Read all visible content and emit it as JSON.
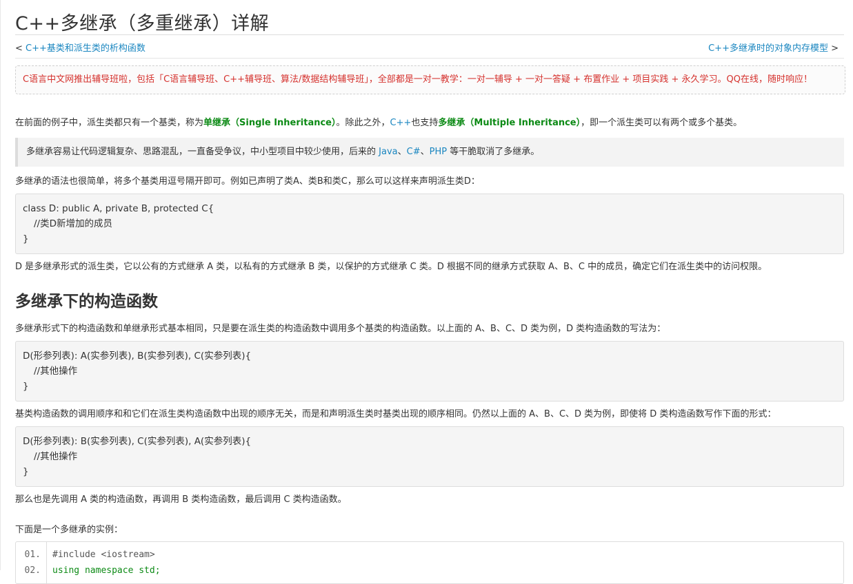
{
  "article": {
    "title": "C++多继承（多重继承）详解",
    "nav": {
      "prev_prefix": "< ",
      "prev_label": "C++基类和派生类的析构函数",
      "next_label": "C++多继承时的对象内存模型",
      "next_suffix": " >"
    },
    "notice": "C语言中文网推出辅导班啦，包括「C语言辅导班、C++辅导班、算法/数据结构辅导班」，全部都是一对一教学：一对一辅导 + 一对一答疑 + 布置作业 + 项目实践 + 永久学习。QQ在线，随时响应！",
    "intro": {
      "p1": "在前面的例子中，派生类都只有一个基类，称为",
      "single": "单继承（Single Inheritance）",
      "p2": "。除此之外，",
      "cpp_link": "C++",
      "p3": "也支持",
      "multiple": "多继承（Multiple Inheritance）",
      "p4": "，即一个派生类可以有两个或多个基类。"
    },
    "quote": {
      "t1": "多继承容易让代码逻辑复杂、思路混乱，一直备受争议，中小型项目中较少使用，后来的 ",
      "java": "Java",
      "sep1": "、",
      "csharp": "C#",
      "sep2": "、",
      "php": "PHP",
      "t2": " 等干脆取消了多继承。"
    },
    "syntax_text": "多继承的语法也很简单，将多个基类用逗号隔开即可。例如已声明了类A、类B和类C，那么可以这样来声明派生类D：",
    "code1": [
      "class D: public A, private B, protected C{",
      "//类D新增加的成员",
      "}"
    ],
    "explain_text": "D 是多继承形式的派生类，它以公有的方式继承 A 类，以私有的方式继承 B 类，以保护的方式继承 C 类。D 根据不同的继承方式获取 A、B、C 中的成员，确定它们在派生类中的访问权限。",
    "section_title": "多继承下的构造函数",
    "ctor_text": "多继承形式下的构造函数和单继承形式基本相同，只是要在派生类的构造函数中调用多个基类的构造函数。以上面的 A、B、C、D 类为例，D 类构造函数的写法为：",
    "code2": [
      "D(形参列表): A(实参列表), B(实参列表), C(实参列表){",
      "//其他操作",
      "}"
    ],
    "order_text": "基类构造函数的调用顺序和和它们在派生类构造函数中出现的顺序无关，而是和声明派生类时基类出现的顺序相同。仍然以上面的 A、B、C、D 类为例，即使将 D 类构造函数写作下面的形式：",
    "code3": [
      "D(形参列表): B(实参列表), C(实参列表), A(实参列表){",
      "//其他操作",
      "}"
    ],
    "then_text": "那么也是先调用 A 类的构造函数，再调用 B 类构造函数，最后调用 C 类构造函数。",
    "example_intro": "下面是一个多继承的实例：",
    "example": {
      "lines": [
        {
          "num": "01.",
          "code": "#include <iostream>"
        },
        {
          "num": "02.",
          "code": "using namespace std;"
        }
      ]
    }
  }
}
